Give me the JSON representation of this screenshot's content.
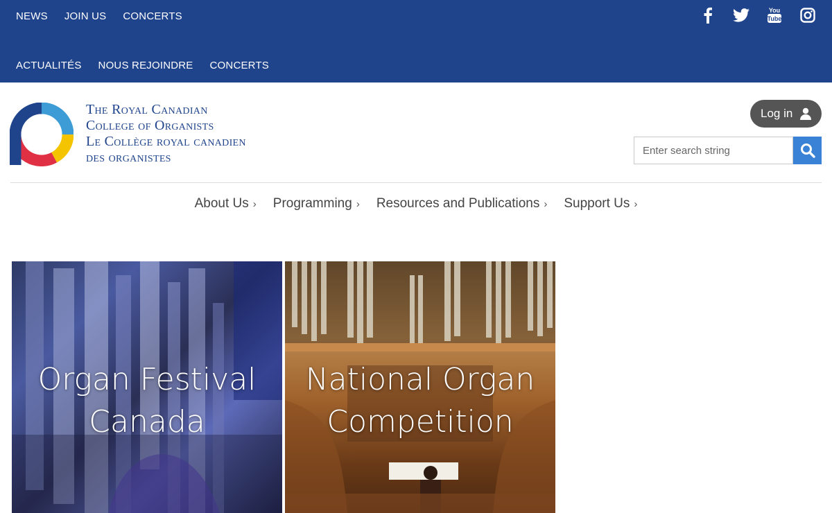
{
  "top_nav_en": [
    "NEWS",
    "JOIN US",
    "CONCERTS"
  ],
  "top_nav_fr": [
    "ACTUALITÉS",
    "NOUS REJOINDRE",
    "CONCERTS"
  ],
  "social_icons": [
    "facebook-icon",
    "twitter-icon",
    "youtube-icon",
    "instagram-icon"
  ],
  "org": {
    "line1": "The Royal Canadian",
    "line2": "College of Organists",
    "line3": "Le Collège royal canadien",
    "line4": "des organistes"
  },
  "header": {
    "login_label": "Log in",
    "search_placeholder": "Enter search string"
  },
  "main_nav": [
    "About Us",
    "Programming",
    "Resources and Publications",
    "Support Us"
  ],
  "tiles": {
    "tile1_line1": "Organ Festival",
    "tile1_line2": "Canada",
    "tile2_line1": "National Organ",
    "tile2_line2": "Competition"
  },
  "colors": {
    "top_bar": "#1f448c",
    "search_button": "#3a82d6",
    "login_button": "#555555"
  }
}
